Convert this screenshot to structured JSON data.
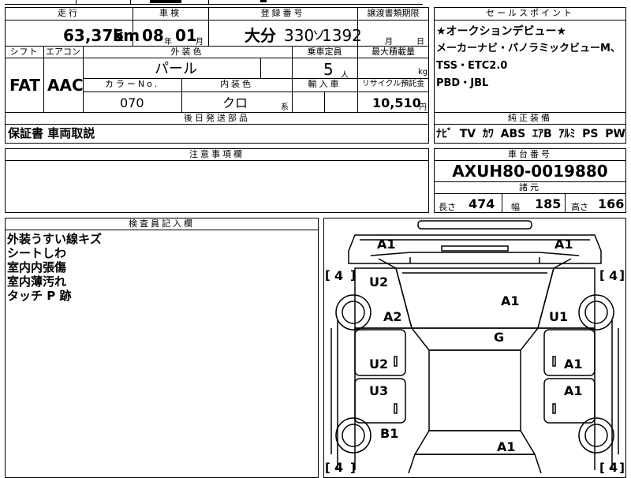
{
  "header": {
    "mileage_label": "走行",
    "inspection_label": "車検",
    "registration_label": "登録番号",
    "transfer_label": "譲渡書類期限",
    "sales_point_label": "セールスポイント",
    "mileage": "63,375",
    "mileage_unit": "km",
    "inspection_year": "08",
    "year_unit": "年",
    "inspection_month": "01",
    "month_unit": "月",
    "registration_region": "大分",
    "registration_class": "330",
    "registration_kana": "ソ",
    "registration_number": "1392",
    "transfer_month_unit": "月",
    "transfer_day_unit": "日"
  },
  "spec": {
    "shift_label": "シフト",
    "aircon_label": "エアコン",
    "exterior_color_label": "外装色",
    "capacity_label": "乗車定員",
    "max_load_label": "最大積載量",
    "shift": "FAT",
    "aircon": "AAC",
    "exterior_color": "パール",
    "capacity": "5",
    "capacity_unit": "人",
    "load_unit": "kg",
    "color_no_label": "カラーNo.",
    "interior_color_label": "内装色",
    "import_label": "輸入車",
    "recycle_label": "リサイクル預託金",
    "color_no": "070",
    "interior_color": "クロ",
    "interior_suffix": "系",
    "recycle_fee": "10,510",
    "recycle_unit": "円"
  },
  "sales_points": [
    "★オークションデビュー★",
    "メーカーナビ・パノラミックビューM、",
    "TSS・ETC2.0",
    "PBD・JBL"
  ],
  "later_parts": {
    "label": "後日発送部品",
    "text": "保証書 車両取説"
  },
  "equipment": {
    "label": "純正装備",
    "items": [
      "ﾅﾋﾞ",
      "TV",
      "ｶﾜ",
      "ABS",
      "ｴｱB",
      "ｱﾙﾐ",
      "PS",
      "PW"
    ]
  },
  "notes": {
    "label": "注意事項欄"
  },
  "chassis": {
    "label": "車台番号",
    "number": "AXUH80-0019880",
    "dimensions_label": "諸元",
    "length_label": "長さ",
    "length": "474",
    "width_label": "幅",
    "width": "185",
    "height_label": "高さ",
    "height": "166"
  },
  "inspector": {
    "label": "検査員記入欄",
    "lines": [
      "外装うすい線キズ",
      "シートしわ",
      "室内内張傷",
      "室内薄汚れ",
      "タッチ P 跡"
    ]
  },
  "diagram": {
    "marks": {
      "front_left_corner": "A1",
      "front_right_corner": "A1",
      "hood": "A1",
      "left_fender": "U2",
      "left_front_door_panel": "A2",
      "right_fender": "U1",
      "roof": "G",
      "left_front_door": "U2",
      "right_front_door": "A1",
      "left_rear_door": "U3",
      "right_rear_door": "A1",
      "left_quarter": "B1",
      "rear": "A1"
    },
    "tires": {
      "front_left": "4",
      "front_right": "4",
      "rear_left": "4",
      "rear_right": "4"
    }
  }
}
